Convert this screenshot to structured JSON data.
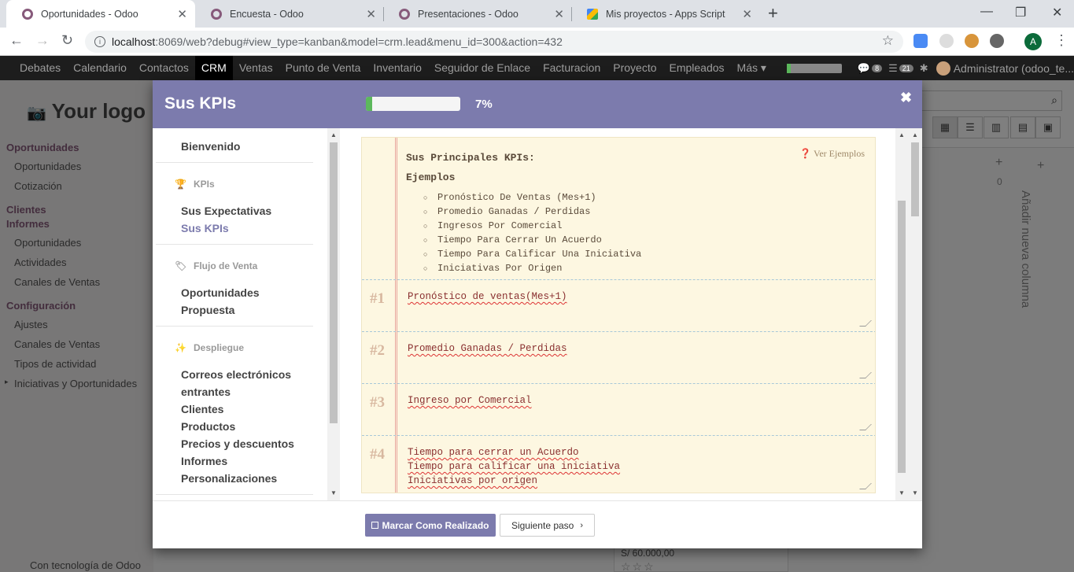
{
  "browser": {
    "tabs": [
      {
        "title": "Oportunidades - Odoo",
        "active": true
      },
      {
        "title": "Encuesta - Odoo",
        "active": false
      },
      {
        "title": "Presentaciones - Odoo",
        "active": false
      },
      {
        "title": "Mis proyectos - Apps Script",
        "active": false
      }
    ],
    "url_host": "localhost",
    "url_rest": ":8069/web?debug#view_type=kanban&model=crm.lead&menu_id=300&action=432",
    "profile_initial": "A"
  },
  "navbar": {
    "items": [
      "Debates",
      "Calendario",
      "Contactos",
      "CRM",
      "Ventas",
      "Punto de Venta",
      "Inventario",
      "Seguidor de Enlace",
      "Facturacion",
      "Proyecto",
      "Empleados",
      "Más"
    ],
    "active": "CRM",
    "badge_messages": "8",
    "badge_activities": "21",
    "user": "Administrator (odoo_te..."
  },
  "sidebar": {
    "logo": "Your logo",
    "sections": [
      {
        "title": "Oportunidades",
        "items": [
          "Oportunidades",
          "Cotización"
        ]
      },
      {
        "title": "Clientes",
        "items": []
      },
      {
        "title": "Informes",
        "items": [
          "Oportunidades",
          "Actividades",
          "Canales de Ventas"
        ]
      },
      {
        "title": "Configuración",
        "items": [
          "Ajustes",
          "Canales de Ventas",
          "Tipos de actividad",
          "Iniciativas y Oportunidades"
        ]
      }
    ],
    "powered_by": "Con tecnología de Odoo"
  },
  "kanban": {
    "add_column": "Añadir nueva columna",
    "col_count": "0",
    "card_amount": "S/ 60.000,00"
  },
  "modal": {
    "title": "Sus KPIs",
    "progress_pct": 7,
    "progress_label": "7%",
    "nav": {
      "welcome": "Bienvenido",
      "group_kpis": "KPIs",
      "kpi_items": [
        "Sus Expectativas",
        "Sus KPIs"
      ],
      "group_flow": "Flujo de Venta",
      "flow_items": [
        "Oportunidades",
        "Propuesta"
      ],
      "group_deploy": "Despliegue",
      "deploy_items": [
        "Correos electrónicos",
        "entrantes",
        "Clientes",
        "Productos",
        "Precios y descuentos",
        "Informes",
        "Personalizaciones"
      ]
    },
    "content": {
      "see_examples": "Ver Ejemplos",
      "heading": "Sus Principales KPIs:",
      "examples_title": "Ejemplos",
      "examples": [
        "Pronóstico De Ventas (Mes+1)",
        "Promedio Ganadas / Perdidas",
        "Ingresos Por Comercial",
        "Tiempo Para Cerrar Un Acuerdo",
        "Tiempo Para Calificar Una Iniciativa",
        "Iniciativas Por Origen"
      ],
      "kpis": [
        {
          "num": "#1",
          "text": "Pronóstico de ventas(Mes+1)"
        },
        {
          "num": "#2",
          "text": "Promedio Ganadas / Perdidas"
        },
        {
          "num": "#3",
          "text": "Ingreso por Comercial"
        },
        {
          "num": "#4",
          "text": "Tiempo para cerrar un Acuerdo\nTiempo para calificar una iniciativa\nIniciativas por origen"
        }
      ]
    },
    "footer": {
      "done_label": "Marcar Como Realizado",
      "next_label": "Siguiente paso"
    }
  }
}
